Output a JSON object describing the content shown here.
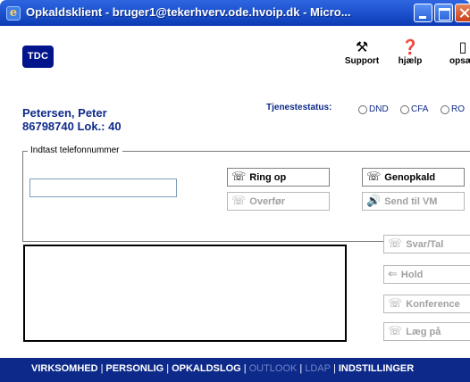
{
  "window": {
    "title": "Opkaldsklient - bruger1@tekerhverv.ode.hvoip.dk - Micro...",
    "icons": [
      "ie-icon",
      "minimize-icon",
      "maximize-icon",
      "close-icon"
    ]
  },
  "header": {
    "logo": "TDC",
    "tools": [
      {
        "label": "Support",
        "icon": "tools-icon",
        "glyph": "⚒"
      },
      {
        "label": "hjælp",
        "icon": "help-icon",
        "glyph": "❓"
      },
      {
        "label": "opsæt",
        "icon": "settings-icon",
        "glyph": "▯"
      }
    ]
  },
  "user": {
    "name": "Petersen, Peter",
    "number": "86798740 Lok.: 40"
  },
  "status": {
    "label": "Tjenestestatus:",
    "options": [
      "DND",
      "CFA",
      "RO"
    ]
  },
  "dial": {
    "legend": "Indtast telefonnummer",
    "value": "",
    "placeholder": ""
  },
  "buttons": {
    "ring_op": "Ring op",
    "genopkald": "Genopkald",
    "overfor": "Overfør",
    "send_vm": "Send til VM",
    "svar": "Svar/Tal",
    "hold": "Hold",
    "konference": "Konference",
    "laeg_pa": "Læg på"
  },
  "icons": {
    "ring_op": "☏",
    "genopkald": "☏",
    "overfor": "☏",
    "send_vm": "🔊",
    "svar": "☏",
    "hold": "⇐",
    "konference": "☏",
    "laeg_pa": "☏"
  },
  "nav": {
    "items": [
      {
        "label": "VIRKSOMHED",
        "enabled": true
      },
      {
        "label": "PERSONLIG",
        "enabled": true
      },
      {
        "label": "OPKALDSLOG",
        "enabled": true
      },
      {
        "label": "OUTLOOK",
        "enabled": false
      },
      {
        "label": "LDAP",
        "enabled": false
      },
      {
        "label": "INDSTILLINGER",
        "enabled": true
      }
    ],
    "separator": "|"
  },
  "colors": {
    "brand_blue": "#00148c",
    "text_blue": "#0d2a8a",
    "nav_bg": "#0d2a8a",
    "disabled_text": "#a0a0a0"
  }
}
